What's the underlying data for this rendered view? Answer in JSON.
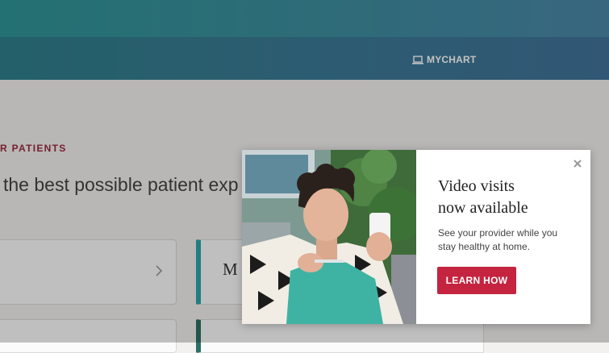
{
  "header": {
    "mychart_label": "MYCHART",
    "mychart_icon": "laptop-icon",
    "colors": {
      "top": "#2f9597",
      "nav": "#2f7f8b"
    }
  },
  "content": {
    "eyebrow": "R PATIENTS",
    "lead": "the best possible patient exp",
    "card_2_label": "M",
    "card_chevron_icon": "chevron-right-icon",
    "accent_colors": [
      "#2aa6aa",
      "#2e6f64"
    ]
  },
  "modal": {
    "title_lines": [
      "Video visits",
      "now available"
    ],
    "body_lines": [
      "See your provider while you",
      "stay healthy at home."
    ],
    "button_label": "LEARN HOW",
    "button_color": "#c4243f",
    "close_icon": "close-icon",
    "photo_icon": "photo"
  }
}
